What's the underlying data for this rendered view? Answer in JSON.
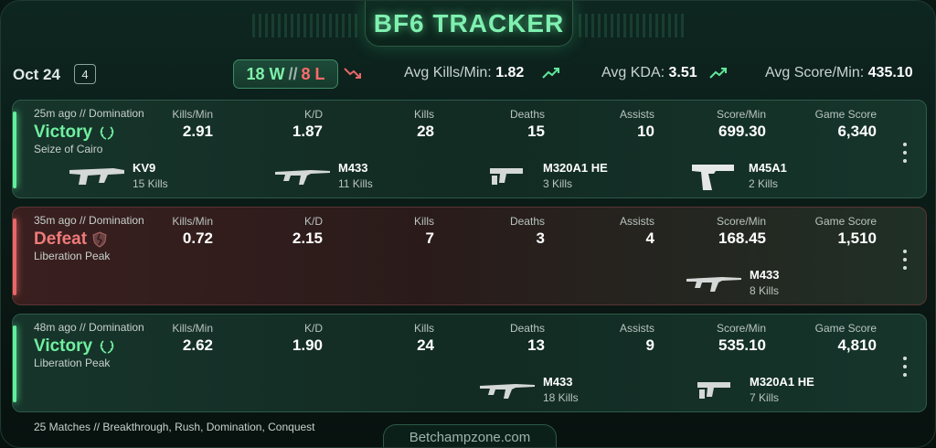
{
  "header": {
    "title": "BF6 TRACKER"
  },
  "summary": {
    "date": "Oct 24",
    "match_count": "4",
    "wins": "18 W",
    "separator": "//",
    "losses": "8 L",
    "avg_kpm_label": "Avg Kills/Min:",
    "avg_kpm_value": "1.82",
    "avg_kda_label": "Avg KDA:",
    "avg_kda_value": "3.51",
    "avg_spm_label": "Avg Score/Min:",
    "avg_spm_value": "435.10",
    "colors": {
      "win": "#7ff0a8",
      "loss": "#ff6b6b"
    }
  },
  "columns": {
    "kpm": "Kills/Min",
    "kd": "K/D",
    "kills": "Kills",
    "deaths": "Deaths",
    "assists": "Assists",
    "spm": "Score/Min",
    "score": "Game Score"
  },
  "matches": [
    {
      "meta": "25m ago // Domination",
      "result": "Victory",
      "map": "Seize of Cairo",
      "kpm": "2.91",
      "kd": "1.87",
      "kills": "28",
      "deaths": "15",
      "assists": "10",
      "spm": "699.30",
      "score": "6,340",
      "weapons": [
        {
          "name": "KV9",
          "kills": "15 Kills",
          "icon": "smg-icon"
        },
        {
          "name": "M433",
          "kills": "11 Kills",
          "icon": "rifle-icon"
        },
        {
          "name": "M320A1 HE",
          "kills": "3 Kills",
          "icon": "grenade-launcher-icon"
        },
        {
          "name": "M45A1",
          "kills": "2 Kills",
          "icon": "pistol-icon"
        }
      ]
    },
    {
      "meta": "35m ago // Domination",
      "result": "Defeat",
      "map": "Liberation Peak",
      "kpm": "0.72",
      "kd": "2.15",
      "kills": "7",
      "deaths": "3",
      "assists": "4",
      "spm": "168.45",
      "score": "1,510",
      "weapons": [
        {
          "name": "M433",
          "kills": "8 Kills",
          "icon": "rifle-icon"
        }
      ]
    },
    {
      "meta": "48m ago // Domination",
      "result": "Victory",
      "map": "Liberation Peak",
      "kpm": "2.62",
      "kd": "1.90",
      "kills": "24",
      "deaths": "13",
      "assists": "9",
      "spm": "535.10",
      "score": "4,810",
      "weapons": [
        {
          "name": "M433",
          "kills": "18 Kills",
          "icon": "rifle-icon"
        },
        {
          "name": "M320A1 HE",
          "kills": "7 Kills",
          "icon": "grenade-launcher-icon"
        }
      ]
    }
  ],
  "footer": {
    "summary": "25 Matches // Breakthrough, Rush, Domination, Conquest",
    "site": "Betchampzone.com"
  }
}
